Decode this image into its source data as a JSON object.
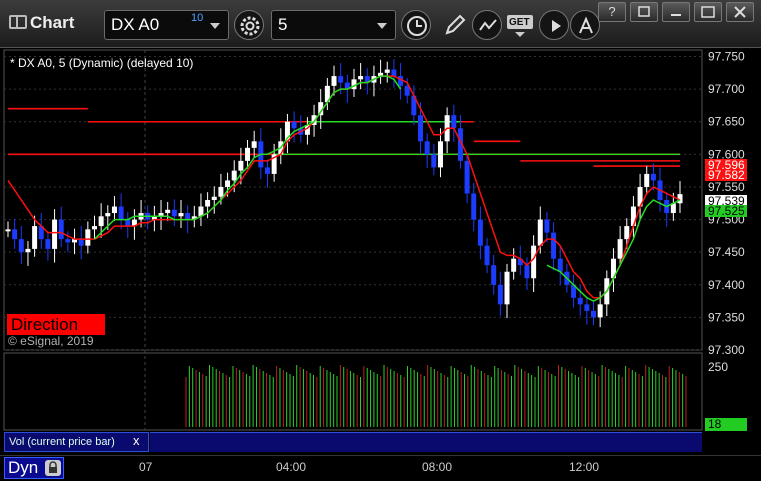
{
  "toolbar": {
    "title": "Chart",
    "symbol": "DX A0",
    "delay_badge": "10",
    "interval": "5",
    "get_label": "GET",
    "window_buttons": [
      "?",
      "",
      "",
      "x"
    ]
  },
  "chart": {
    "label": "* DX A0, 5 (Dynamic) (delayed 10)",
    "direction_label": "Direction",
    "copyright": "© eSignal, 2019",
    "vol_label": "Vol (current price bar)",
    "vol_close": "x",
    "dyn_label": "Dyn"
  },
  "colors": {
    "up_bar": "#ffffff",
    "down_bar": "#1c3cff",
    "red_line": "#ff1010",
    "green_line": "#22dd22",
    "vol_up": "#2bd02b",
    "vol_down": "#c02020"
  },
  "chart_data": {
    "type": "line",
    "price_ticks": [
      "97.750",
      "97.700",
      "97.650",
      "97.600",
      "97.550",
      "97.500",
      "97.450",
      "97.400",
      "97.350",
      "97.300"
    ],
    "price_tags": [
      {
        "text": "97.596",
        "bg": "#ff1010",
        "fg": "#ffffff"
      },
      {
        "text": "97.582",
        "bg": "#ff1010",
        "fg": "#ffffff"
      },
      {
        "text": "97.539",
        "bg": "#ffffff",
        "fg": "#000000"
      },
      {
        "text": "97.525",
        "bg": "#22cc22",
        "fg": "#000000"
      }
    ],
    "volume_ticks": [
      "250"
    ],
    "volume_tag": "18",
    "x_labels": [
      "07",
      "04:00",
      "08:00",
      "12:00"
    ],
    "ylim": [
      97.3,
      97.76
    ],
    "close": [
      97.485,
      97.47,
      97.45,
      97.455,
      97.49,
      97.47,
      97.455,
      97.5,
      97.47,
      97.465,
      97.47,
      97.46,
      97.485,
      97.49,
      97.505,
      97.51,
      97.52,
      97.5,
      97.49,
      97.5,
      97.51,
      97.5,
      97.505,
      97.51,
      97.515,
      97.505,
      97.51,
      97.5,
      97.505,
      97.52,
      97.53,
      97.535,
      97.55,
      97.56,
      97.575,
      97.59,
      97.61,
      97.62,
      97.58,
      97.57,
      97.6,
      97.62,
      97.65,
      97.64,
      97.63,
      97.645,
      97.66,
      97.68,
      97.705,
      97.72,
      97.71,
      97.7,
      97.715,
      97.72,
      97.71,
      97.72,
      97.725,
      97.73,
      97.72,
      97.705,
      97.69,
      97.66,
      97.62,
      97.6,
      97.58,
      97.62,
      97.66,
      97.64,
      97.59,
      97.54,
      97.5,
      97.46,
      97.43,
      97.4,
      97.37,
      97.42,
      97.44,
      97.43,
      97.41,
      97.46,
      97.5,
      97.48,
      97.44,
      97.42,
      97.4,
      97.38,
      97.37,
      97.36,
      97.35,
      97.37,
      97.41,
      97.44,
      97.47,
      97.49,
      97.52,
      97.55,
      97.57,
      97.56,
      97.53,
      97.51,
      97.525,
      97.539
    ],
    "red_line": [
      97.56,
      97.545,
      97.53,
      97.515,
      97.5,
      97.49,
      97.48,
      97.48,
      97.48,
      97.475,
      97.47,
      97.47,
      97.47,
      97.47,
      97.475,
      97.48,
      97.49,
      97.49,
      97.49,
      97.49,
      97.495,
      97.495,
      97.5,
      97.5,
      97.5,
      97.5,
      97.5,
      97.5,
      97.5,
      97.505,
      97.51,
      97.52,
      97.53,
      97.54,
      97.55,
      97.56,
      97.575,
      97.59,
      97.59,
      97.59,
      97.595,
      97.6,
      97.62,
      97.63,
      97.635,
      97.64,
      97.65,
      97.665,
      97.68,
      97.695,
      97.7,
      97.7,
      97.705,
      97.71,
      97.71,
      97.715,
      97.72,
      97.72,
      97.72,
      97.715,
      97.71,
      97.69,
      97.67,
      97.65,
      97.63,
      97.63,
      97.64,
      97.64,
      97.62,
      97.6,
      97.57,
      97.54,
      97.51,
      97.48,
      97.45,
      97.445,
      97.445,
      97.44,
      97.43,
      97.44,
      97.46,
      97.47,
      97.47,
      97.46,
      97.44,
      97.42,
      97.41,
      97.39,
      97.38,
      97.38,
      97.39,
      97.41,
      97.43,
      97.46,
      97.49,
      97.52,
      97.54,
      97.55,
      97.545,
      97.54,
      97.535,
      97.53
    ],
    "green_line": [
      null,
      null,
      null,
      null,
      null,
      null,
      null,
      null,
      null,
      null,
      null,
      null,
      null,
      97.47,
      97.48,
      97.49,
      97.5,
      97.5,
      97.5,
      97.505,
      97.505,
      97.505,
      97.505,
      97.505,
      97.505,
      97.5,
      97.5,
      97.5,
      97.5,
      97.505,
      97.51,
      97.52,
      97.53,
      97.545,
      97.555,
      97.57,
      97.58,
      97.595,
      97.6,
      97.6,
      97.605,
      97.61,
      97.625,
      97.635,
      97.64,
      97.645,
      97.65,
      97.665,
      97.68,
      97.695,
      97.7,
      97.7,
      97.705,
      97.71,
      97.71,
      97.715,
      97.72,
      97.72,
      97.715,
      97.7,
      null,
      null,
      null,
      null,
      null,
      null,
      null,
      null,
      null,
      null,
      null,
      null,
      null,
      null,
      null,
      null,
      null,
      null,
      null,
      null,
      null,
      97.43,
      97.425,
      97.42,
      97.41,
      97.4,
      97.39,
      97.38,
      97.375,
      97.38,
      97.39,
      97.41,
      97.43,
      97.45,
      97.47,
      97.5,
      97.52,
      97.53,
      97.525,
      97.52,
      97.525,
      97.53
    ],
    "red_levels": [
      {
        "x0": 0,
        "x1": 12,
        "y": 97.67
      },
      {
        "x0": 12,
        "x1": 70,
        "y": 97.65
      },
      {
        "x0": 70,
        "x1": 77,
        "y": 97.62
      },
      {
        "x0": 77,
        "x1": 101,
        "y": 97.59
      },
      {
        "x0": 0,
        "x1": 101,
        "y": 97.6
      },
      {
        "x0": 88,
        "x1": 101,
        "y": 97.582
      }
    ],
    "green_levels": [
      {
        "x0": 45,
        "x1": 68,
        "y": 97.65
      },
      {
        "x0": 40,
        "x1": 101,
        "y": 97.6
      }
    ]
  }
}
